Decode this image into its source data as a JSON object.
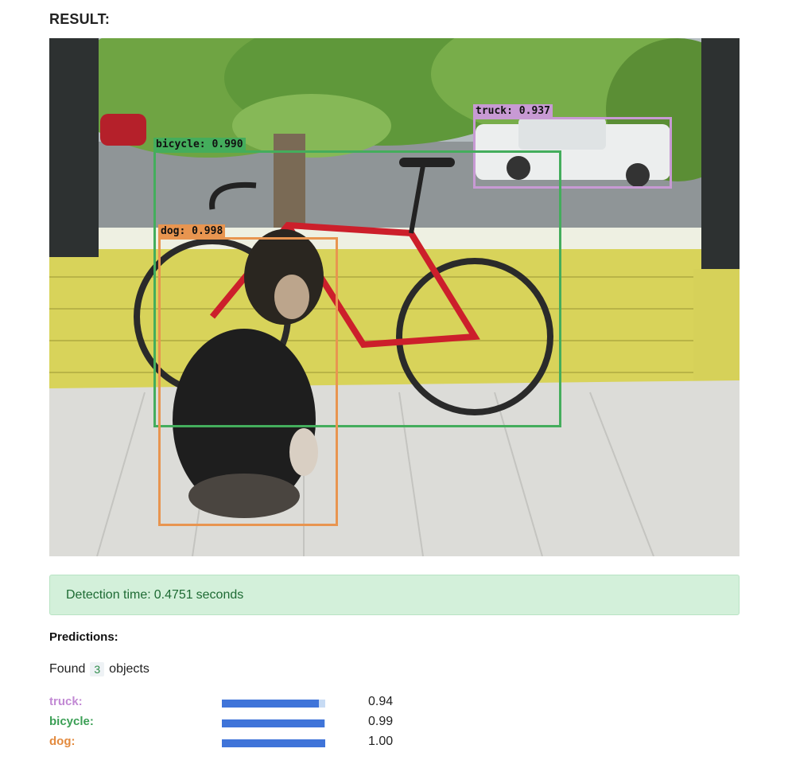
{
  "result_heading": "RESULT:",
  "detections": [
    {
      "label": "truck: 0.937",
      "color": "#c89ad4"
    },
    {
      "label": "bicycle: 0.990",
      "color": "#44ad5c"
    },
    {
      "label": "dog: 0.998",
      "color": "#e89550"
    }
  ],
  "status": {
    "label": "Detection time:",
    "value": "0.4751",
    "unit": "seconds"
  },
  "predictions_heading": "Predictions:",
  "found": {
    "prefix": "Found",
    "count": "3",
    "suffix": "objects"
  },
  "predictions": [
    {
      "name": "truck:",
      "score": "0.94",
      "fraction": 0.94,
      "color": "#c289d4"
    },
    {
      "name": "bicycle:",
      "score": "0.99",
      "fraction": 0.99,
      "color": "#3b9f55"
    },
    {
      "name": "dog:",
      "score": "1.00",
      "fraction": 1.0,
      "color": "#e38a3e"
    }
  ]
}
